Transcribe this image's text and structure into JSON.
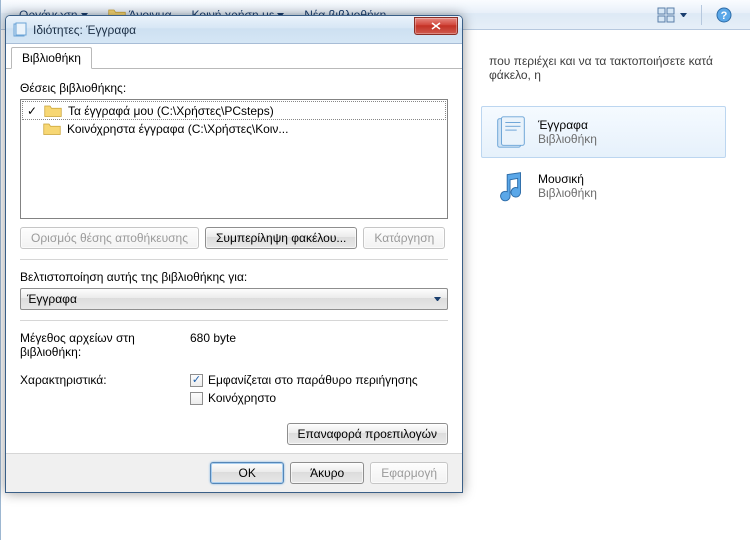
{
  "explorer": {
    "toolbar": {
      "items": [
        "Οργάνωση",
        "Άνοιγμα",
        "Κοινή χρήση με",
        "Νέα βιβλιοθήκη"
      ]
    },
    "hint": "που περιέχει και να τα τακτοποιήσετε κατά φάκελο, η",
    "libraries": [
      {
        "title": "Έγγραφα",
        "sub": "Βιβλιοθήκη"
      },
      {
        "title": "Μουσική",
        "sub": "Βιβλιοθήκη"
      }
    ]
  },
  "dialog": {
    "title": "Ιδιότητες: Έγγραφα",
    "tab": "Βιβλιοθήκη",
    "locations_label": "Θέσεις βιβλιοθήκης:",
    "locations": [
      {
        "checked": true,
        "text": "Τα έγγραφά μου (C:\\Χρήστες\\PCsteps)"
      },
      {
        "checked": false,
        "text": "Κοινόχρηστα έγγραφα (C:\\Χρήστες\\Κοιν..."
      }
    ],
    "buttons": {
      "set_save": "Ορισμός θέσης αποθήκευσης",
      "include": "Συμπερίληψη φακέλου...",
      "remove": "Κατάργηση"
    },
    "optimize_label": "Βελτιστοποίηση αυτής της βιβλιοθήκης για:",
    "optimize_value": "Έγγραφα",
    "size_label": "Μέγεθος αρχείων στη βιβλιοθήκη:",
    "size_value": "680 byte",
    "attr_label": "Χαρακτηριστικά:",
    "checkbox_nav": "Εμφανίζεται στο παράθυρο περιήγησης",
    "checkbox_shared": "Κοινόχρηστο",
    "restore": "Επαναφορά προεπιλογών",
    "ok": "OK",
    "cancel": "Άκυρο",
    "apply": "Εφαρμογή"
  }
}
